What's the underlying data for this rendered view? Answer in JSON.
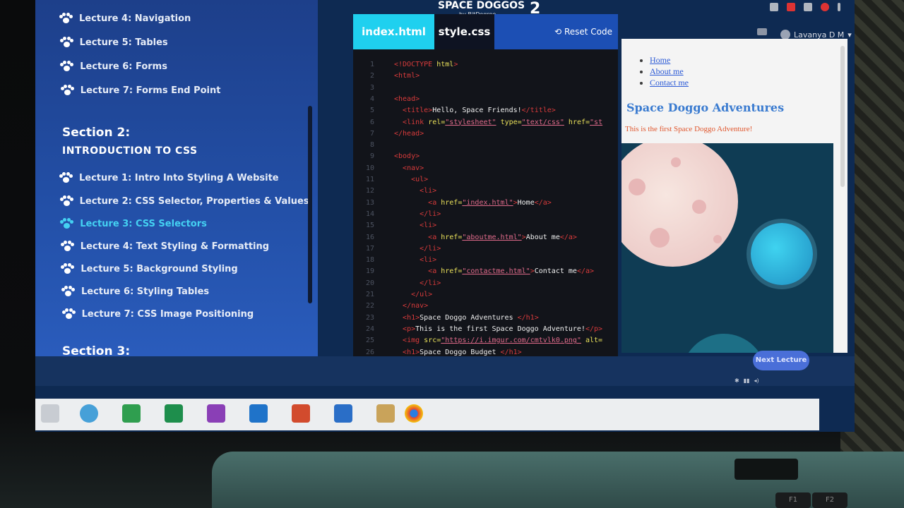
{
  "app": {
    "logo_text": "SPACE DOGGOS",
    "logo_number": "2",
    "logo_sub": "by BitDegree"
  },
  "header": {
    "user_name": "Lavanya D M"
  },
  "sidebar": {
    "section1_items": [
      {
        "label": "Lecture 4: Navigation"
      },
      {
        "label": "Lecture 5: Tables"
      },
      {
        "label": "Lecture 6: Forms"
      },
      {
        "label": "Lecture 7: Forms End Point"
      }
    ],
    "section2_heading": "Section 2:",
    "section2_title": "INTRODUCTION TO CSS",
    "section2_items": [
      {
        "label": "Lecture 1: Intro Into Styling A Website"
      },
      {
        "label": "Lecture 2: CSS Selector, Properties & Values"
      },
      {
        "label": "Lecture 3: CSS Selectors",
        "active": true
      },
      {
        "label": "Lecture 4: Text Styling & Formatting"
      },
      {
        "label": "Lecture 5: Background Styling"
      },
      {
        "label": "Lecture 6: Styling Tables"
      },
      {
        "label": "Lecture 7: CSS Image Positioning"
      }
    ],
    "section3_heading": "Section 3:"
  },
  "editor": {
    "tabs": [
      {
        "label": "index.html",
        "active": true
      },
      {
        "label": "style.css",
        "active": false
      }
    ],
    "reset_label": "Reset Code",
    "lines": [
      {
        "n": "1",
        "html": "<span class='tg'>&lt;!DOCTYPE</span> <span class='at'>html</span><span class='tg'>&gt;</span>"
      },
      {
        "n": "2",
        "html": "<span class='tg'>&lt;html&gt;</span>"
      },
      {
        "n": "3",
        "html": ""
      },
      {
        "n": "4",
        "html": "<span class='tg'>&lt;head&gt;</span>"
      },
      {
        "n": "5",
        "html": "  <span class='tg'>&lt;title&gt;</span>Hello, Space Friends!<span class='tg'>&lt;/title&gt;</span>"
      },
      {
        "n": "6",
        "html": "  <span class='tg'>&lt;link</span> <span class='at'>rel=</span><span class='st'>\"stylesheet\"</span> <span class='at'>type=</span><span class='st'>\"text/css\"</span> <span class='at'>href=</span><span class='st'>\"st</span>"
      },
      {
        "n": "7",
        "html": "<span class='tg'>&lt;/head&gt;</span>"
      },
      {
        "n": "8",
        "html": ""
      },
      {
        "n": "9",
        "html": "<span class='tg'>&lt;body&gt;</span>"
      },
      {
        "n": "10",
        "html": "  <span class='tg'>&lt;nav&gt;</span>"
      },
      {
        "n": "11",
        "html": "    <span class='tg'>&lt;ul&gt;</span>"
      },
      {
        "n": "12",
        "html": "      <span class='tg'>&lt;li&gt;</span>"
      },
      {
        "n": "13",
        "html": "        <span class='tg'>&lt;a</span> <span class='at'>href=</span><span class='st'>\"index.html\"</span><span class='tg'>&gt;</span>Home<span class='tg'>&lt;/a&gt;</span>"
      },
      {
        "n": "14",
        "html": "      <span class='tg'>&lt;/li&gt;</span>"
      },
      {
        "n": "15",
        "html": "      <span class='tg'>&lt;li&gt;</span>"
      },
      {
        "n": "16",
        "html": "        <span class='tg'>&lt;a</span> <span class='at'>href=</span><span class='st'>\"aboutme.html\"</span><span class='tg'>&gt;</span>About me<span class='tg'>&lt;/a&gt;</span>"
      },
      {
        "n": "17",
        "html": "      <span class='tg'>&lt;/li&gt;</span>"
      },
      {
        "n": "18",
        "html": "      <span class='tg'>&lt;li&gt;</span>"
      },
      {
        "n": "19",
        "html": "        <span class='tg'>&lt;a</span> <span class='at'>href=</span><span class='st'>\"contactme.html\"</span><span class='tg'>&gt;</span>Contact me<span class='tg'>&lt;/a&gt;</span>"
      },
      {
        "n": "20",
        "html": "      <span class='tg'>&lt;/li&gt;</span>"
      },
      {
        "n": "21",
        "html": "    <span class='tg'>&lt;/ul&gt;</span>"
      },
      {
        "n": "22",
        "html": "  <span class='tg'>&lt;/nav&gt;</span>"
      },
      {
        "n": "23",
        "html": "  <span class='tg'>&lt;h1&gt;</span>Space Doggo Adventures <span class='tg'>&lt;/h1&gt;</span>"
      },
      {
        "n": "24",
        "html": "  <span class='tg'>&lt;p&gt;</span>This is the first Space Doggo Adventure!<span class='tg'>&lt;/p&gt;</span>"
      },
      {
        "n": "25",
        "html": "  <span class='tg'>&lt;img</span> <span class='at'>src=</span><span class='st'>\"https://i.imgur.com/cmtvlk0.png\"</span> <span class='at'>alt=</span>"
      },
      {
        "n": "26",
        "html": "  <span class='tg'>&lt;h1&gt;</span>Space Doggo Budget <span class='tg'>&lt;/h1&gt;</span>"
      }
    ]
  },
  "preview": {
    "nav_items": [
      "Home",
      "About me",
      "Contact me"
    ],
    "heading": "Space Doggo Adventures",
    "paragraph": "This is the first Space Doggo Adventure!"
  },
  "footer": {
    "next_label": "Next Lecture"
  },
  "keyboard": {
    "f1": "F1",
    "f2": "F2"
  }
}
